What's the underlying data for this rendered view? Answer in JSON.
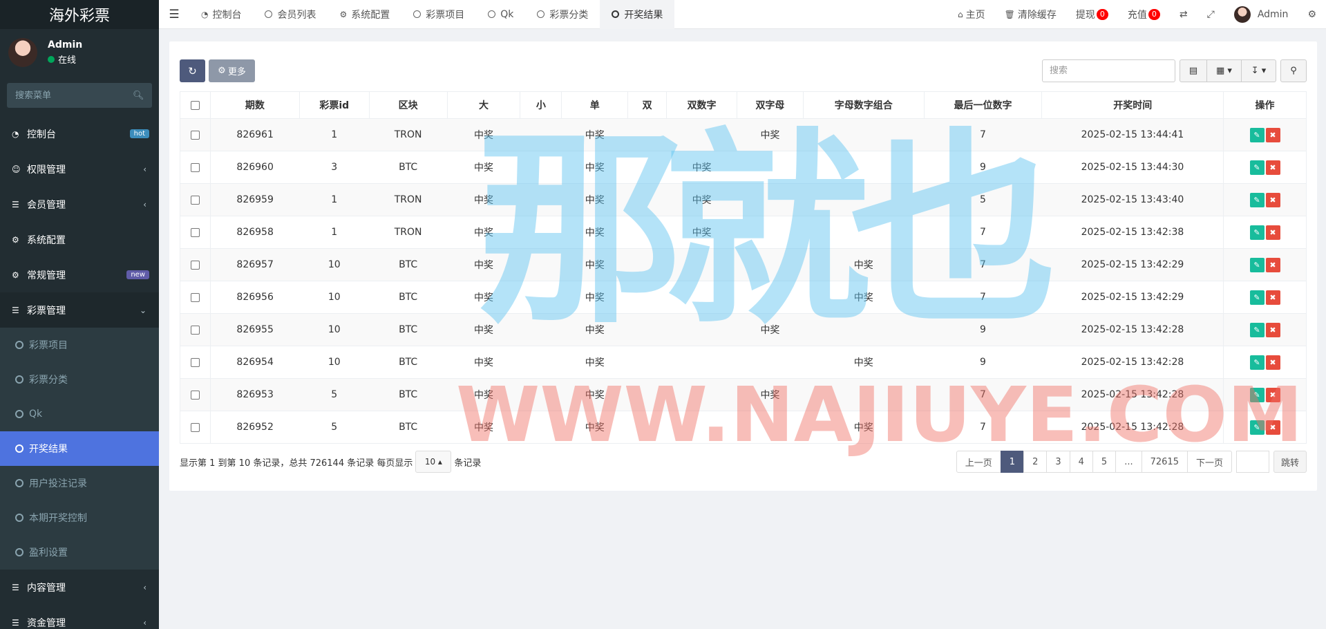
{
  "sidebar": {
    "logo": "海外彩票",
    "user": {
      "name": "Admin",
      "status": "在线"
    },
    "search_placeholder": "搜索菜单",
    "menu": [
      {
        "label": "控制台",
        "icon": "dashboard-icon",
        "badge": "hot"
      },
      {
        "label": "权限管理",
        "icon": "users-icon"
      },
      {
        "label": "会员管理",
        "icon": "list-icon"
      },
      {
        "label": "系统配置",
        "icon": "gear-icon"
      },
      {
        "label": "常规管理",
        "icon": "cogs-icon",
        "badge": "new"
      },
      {
        "label": "彩票管理",
        "icon": "list-icon"
      }
    ],
    "submenu": [
      "彩票项目",
      "彩票分类",
      "Qk",
      "开奖结果",
      "用户投注记录",
      "本期开奖控制",
      "盈利设置"
    ],
    "menu_after": [
      {
        "label": "内容管理",
        "icon": "list-icon"
      },
      {
        "label": "资金管理",
        "icon": "list-icon"
      }
    ]
  },
  "navbar": {
    "tabs": [
      "控制台",
      "会员列表",
      "系统配置",
      "彩票项目",
      "Qk",
      "彩票分类",
      "开奖结果"
    ],
    "right": {
      "home": "主页",
      "clear_cache": "清除缓存",
      "withdraw": "提现",
      "withdraw_count": "0",
      "recharge": "充值",
      "recharge_count": "0",
      "admin": "Admin"
    }
  },
  "toolbar": {
    "more": "更多",
    "search_placeholder": "搜索"
  },
  "table": {
    "columns": [
      "期数",
      "彩票id",
      "区块",
      "大",
      "小",
      "单",
      "双",
      "双数字",
      "双字母",
      "字母数字组合",
      "最后一位数字",
      "开奖时间",
      "操作"
    ],
    "rows": [
      [
        "826961",
        "1",
        "TRON",
        "中奖",
        "",
        "中奖",
        "",
        "",
        "中奖",
        "",
        "7",
        "2025-02-15 13:44:41"
      ],
      [
        "826960",
        "3",
        "BTC",
        "中奖",
        "",
        "中奖",
        "",
        "中奖",
        "",
        "",
        "9",
        "2025-02-15 13:44:30"
      ],
      [
        "826959",
        "1",
        "TRON",
        "中奖",
        "",
        "中奖",
        "",
        "中奖",
        "",
        "",
        "5",
        "2025-02-15 13:43:40"
      ],
      [
        "826958",
        "1",
        "TRON",
        "中奖",
        "",
        "中奖",
        "",
        "中奖",
        "",
        "",
        "7",
        "2025-02-15 13:42:38"
      ],
      [
        "826957",
        "10",
        "BTC",
        "中奖",
        "",
        "中奖",
        "",
        "",
        "",
        "中奖",
        "7",
        "2025-02-15 13:42:29"
      ],
      [
        "826956",
        "10",
        "BTC",
        "中奖",
        "",
        "中奖",
        "",
        "",
        "",
        "中奖",
        "7",
        "2025-02-15 13:42:29"
      ],
      [
        "826955",
        "10",
        "BTC",
        "中奖",
        "",
        "中奖",
        "",
        "",
        "中奖",
        "",
        "9",
        "2025-02-15 13:42:28"
      ],
      [
        "826954",
        "10",
        "BTC",
        "中奖",
        "",
        "中奖",
        "",
        "",
        "",
        "中奖",
        "9",
        "2025-02-15 13:42:28"
      ],
      [
        "826953",
        "5",
        "BTC",
        "中奖",
        "",
        "中奖",
        "",
        "",
        "中奖",
        "",
        "7",
        "2025-02-15 13:42:28"
      ],
      [
        "826952",
        "5",
        "BTC",
        "中奖",
        "",
        "中奖",
        "",
        "",
        "",
        "中奖",
        "7",
        "2025-02-15 13:42:28"
      ]
    ]
  },
  "footer": {
    "summary": "显示第 1 到第 10 条记录，总共 726144 条记录 每页显示",
    "page_size": "10",
    "suffix": "条记录",
    "pages": [
      "上一页",
      "1",
      "2",
      "3",
      "4",
      "5",
      "...",
      "72615",
      "下一页"
    ],
    "active_page": "1",
    "jump": "跳转"
  },
  "watermark": {
    "cn": "那就也",
    "en": "WWW.NAJIUYE.COM"
  },
  "colors": {
    "sidebar_bg": "#222d32",
    "active_blue": "#4e73df",
    "edit_green": "#18bc9c",
    "delete_red": "#e74c3c"
  }
}
